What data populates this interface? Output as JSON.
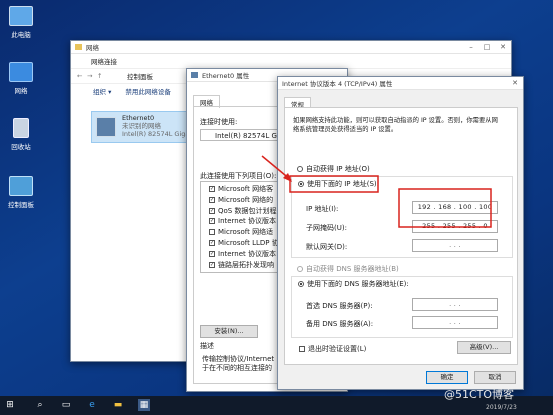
{
  "desktop": {
    "icons": [
      {
        "label": "此电脑"
      },
      {
        "label": "网络"
      },
      {
        "label": "回收站"
      },
      {
        "label": "控制面板"
      }
    ]
  },
  "explorer": {
    "title": "网络",
    "nav_label": "网络连接",
    "toolbar": [
      "组织 ▾",
      "禁用此网络设备"
    ],
    "address": "控制面板",
    "adapter": {
      "name": "Ethernet0",
      "status": "未识别的网络",
      "device": "Intel(R) 82574L Giga"
    }
  },
  "ethernet_props": {
    "title": "Ethernet0 属性",
    "tab": "网络",
    "connect_using_label": "连接时使用:",
    "device": "Intel(R) 82574L Gig",
    "items_label": "此连接使用下列项目(O):",
    "items": [
      "Microsoft 网络客",
      "Microsoft 网络的",
      "QoS 数据包计划程",
      "Internet 协议版本",
      "Microsoft 网络适",
      "Microsoft LLDP 协",
      "Internet 协议版本",
      "链路层拓扑发现响"
    ],
    "install_button": "安装(N)...",
    "desc_label": "描述",
    "desc_text_1": "传输控制协议/Internet",
    "desc_text_2": "于在不同的相互连接的"
  },
  "ipv4": {
    "title": "Internet 协议版本 4 (TCP/IPv4) 属性",
    "tab": "常规",
    "intro_1": "如果网络支持此功能，则可以获取自动指派的 IP 设置。否则，你需要从网",
    "intro_2": "络系统管理员处获得适当的 IP 设置。",
    "auto_ip": "自动获得 IP 地址(O)",
    "manual_ip": "使用下面的 IP 地址(S):",
    "ip_label": "IP 地址(I):",
    "ip_value": "192 . 168 . 100 . 100",
    "mask_label": "子网掩码(U):",
    "mask_value": "255 . 255 . 255 .  0",
    "gateway_label": "默认网关(D):",
    "gateway_value": ".        .        .",
    "auto_dns": "自动获得 DNS 服务器地址(B)",
    "manual_dns": "使用下面的 DNS 服务器地址(E):",
    "dns1_label": "首选 DNS 服务器(P):",
    "dns1_value": ".        .        .",
    "dns2_label": "备用 DNS 服务器(A):",
    "dns2_value": ".        .        .",
    "validate": "退出时验证设置(L)",
    "advanced": "高级(V)...",
    "ok": "确定",
    "cancel": "取消"
  },
  "taskbar": {
    "watermark": "@51CTO博客",
    "date": "2019/7/23"
  },
  "colors": {
    "highlight": "#d9231d",
    "accent": "#0078d7"
  }
}
